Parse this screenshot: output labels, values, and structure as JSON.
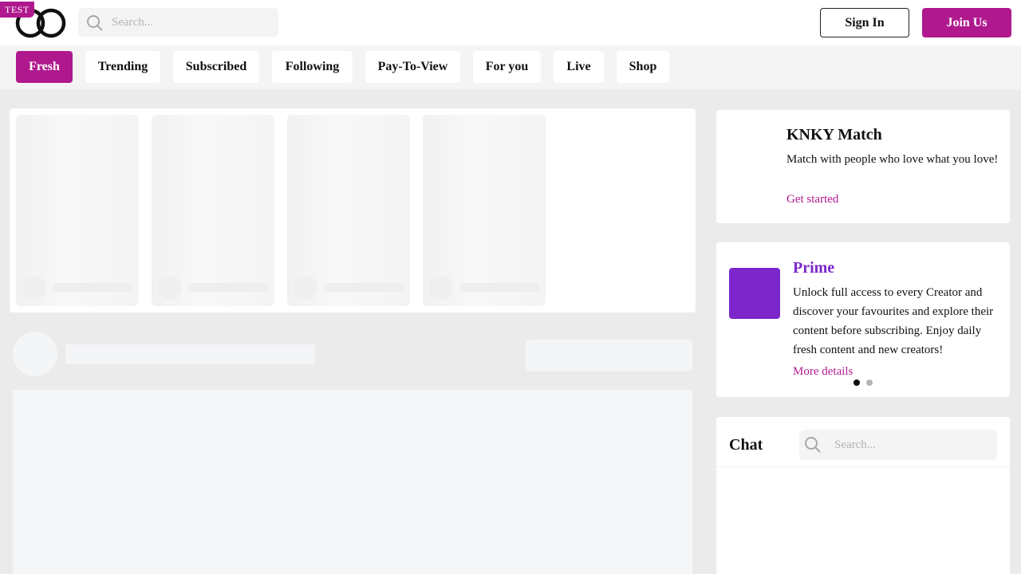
{
  "header": {
    "env_badge": "TEST",
    "search_placeholder": "Search...",
    "sign_in_label": "Sign In",
    "join_label": "Join Us"
  },
  "tabs": [
    {
      "label": "Fresh",
      "active": true
    },
    {
      "label": "Trending",
      "active": false
    },
    {
      "label": "Subscribed",
      "active": false
    },
    {
      "label": "Following",
      "active": false
    },
    {
      "label": "Pay-To-View",
      "active": false
    },
    {
      "label": "For you",
      "active": false
    },
    {
      "label": "Live",
      "active": false
    },
    {
      "label": "Shop",
      "active": false
    }
  ],
  "sidebar": {
    "match": {
      "title": "KNKY Match",
      "description": "Match with people who love what you love!",
      "link": "Get started"
    },
    "prime": {
      "title": "Prime",
      "description": "Unlock full access to every Creator and discover your favourites and explore their content before subscribing. Enjoy daily fresh content and new creators!",
      "link": "More details",
      "carousel_pages": 2,
      "carousel_active": 1
    },
    "chat": {
      "title": "Chat",
      "search_placeholder": "Search..."
    }
  },
  "colors": {
    "brand": "#b0198e",
    "prime": "#7b27cc"
  }
}
